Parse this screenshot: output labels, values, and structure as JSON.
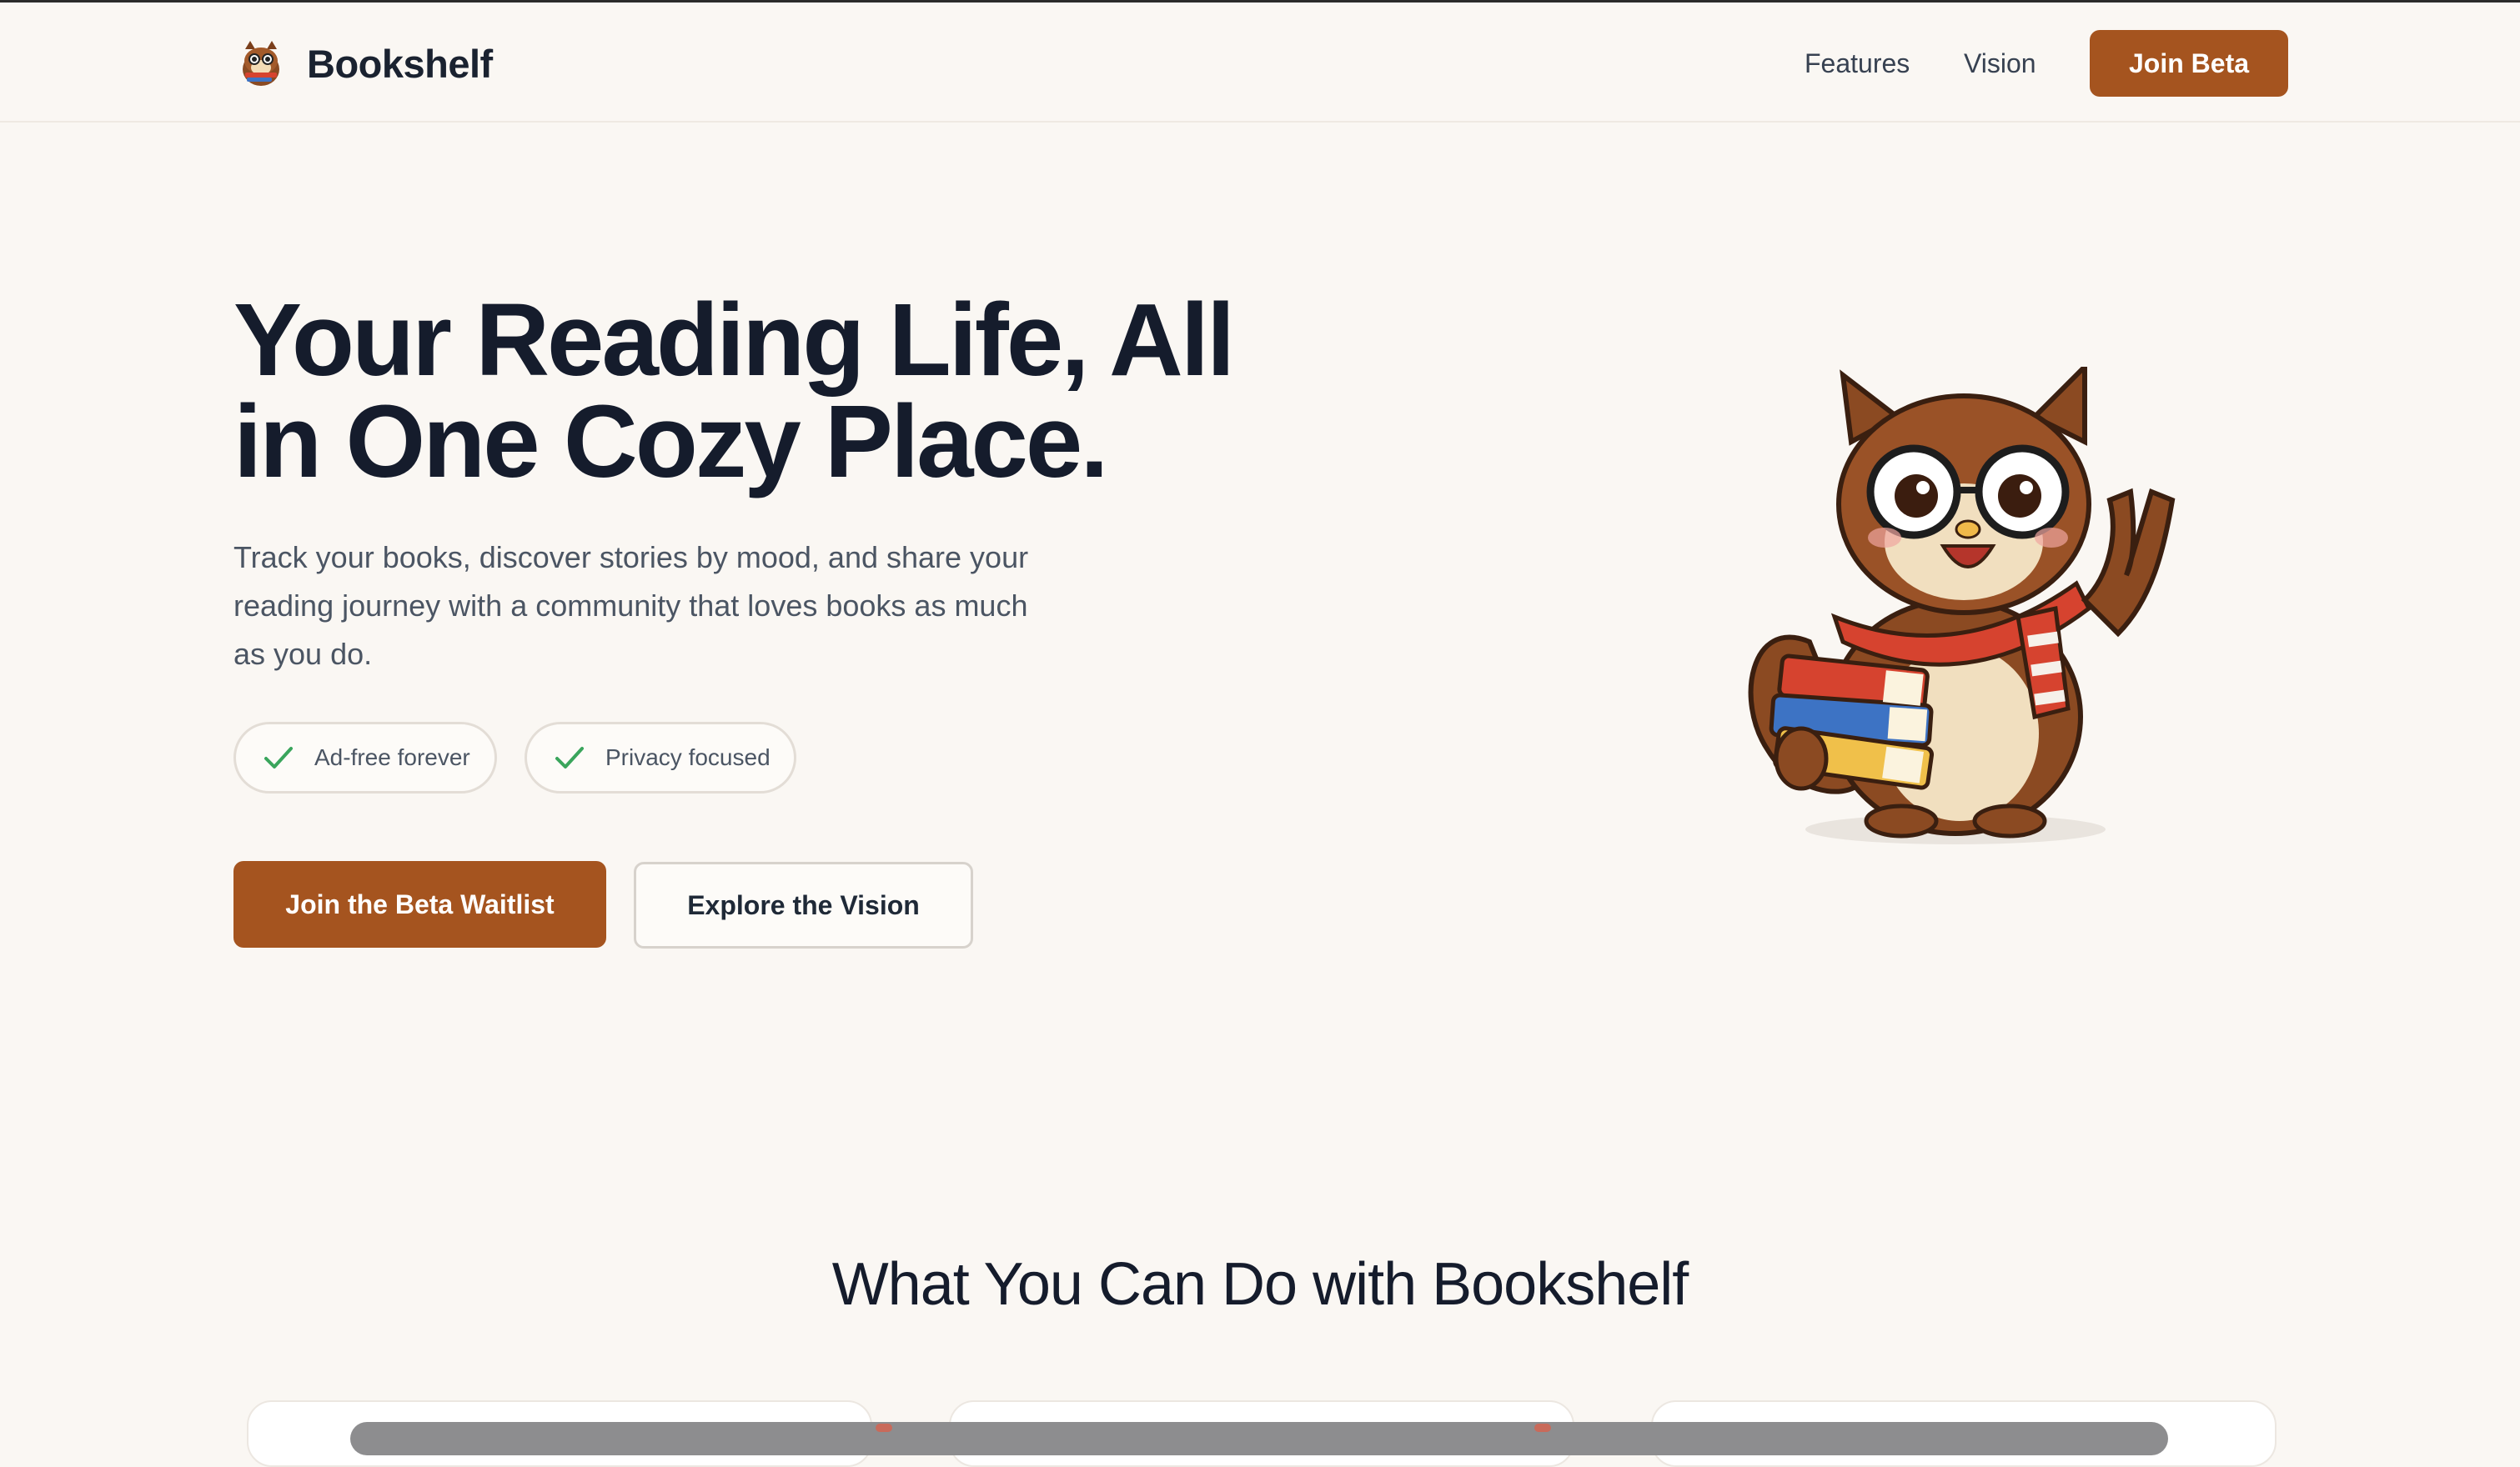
{
  "header": {
    "brand_name": "Bookshelf",
    "nav": {
      "features": "Features",
      "vision": "Vision",
      "join_beta": "Join Beta"
    }
  },
  "hero": {
    "title_line1": "Your Reading Life, All",
    "title_line2": "in One Cozy Place.",
    "subtitle": "Track your books, discover stories by mood, and share your reading journey with a community that loves books as much as you do.",
    "badges": {
      "ad_free": "Ad-free forever",
      "privacy": "Privacy focused"
    },
    "cta_primary": "Join the Beta Waitlist",
    "cta_secondary": "Explore the Vision"
  },
  "features_section": {
    "title": "What You Can Do with Bookshelf"
  },
  "colors": {
    "accent": "#a5541f",
    "background": "#faf7f3",
    "check": "#3aa55c",
    "heading": "#151c2c"
  },
  "icons": {
    "brand": "squirrel-mascot-icon",
    "badge": "check-icon"
  }
}
